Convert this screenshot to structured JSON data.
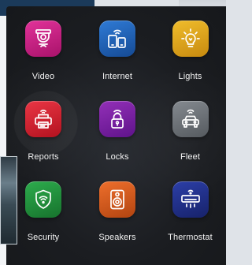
{
  "tiles": [
    {
      "label": "Video",
      "icon": "camera-icon",
      "color": "#c2187a"
    },
    {
      "label": "Internet",
      "icon": "devices-wifi-icon",
      "color": "#1e5fb3"
    },
    {
      "label": "Lights",
      "icon": "lightbulb-icon",
      "color": "#d9a11a"
    },
    {
      "label": "Reports",
      "icon": "printer-icon",
      "color": "#d3202f"
    },
    {
      "label": "Locks",
      "icon": "padlock-icon",
      "color": "#7b1fa2"
    },
    {
      "label": "Fleet",
      "icon": "car-wifi-icon",
      "color": "#6b7075"
    },
    {
      "label": "Security",
      "icon": "shield-wifi-icon",
      "color": "#1f8f3a"
    },
    {
      "label": "Speakers",
      "icon": "speaker-icon",
      "color": "#d8571a"
    },
    {
      "label": "Thermostat",
      "icon": "air-conditioner-icon",
      "color": "#1f2f8f"
    }
  ]
}
